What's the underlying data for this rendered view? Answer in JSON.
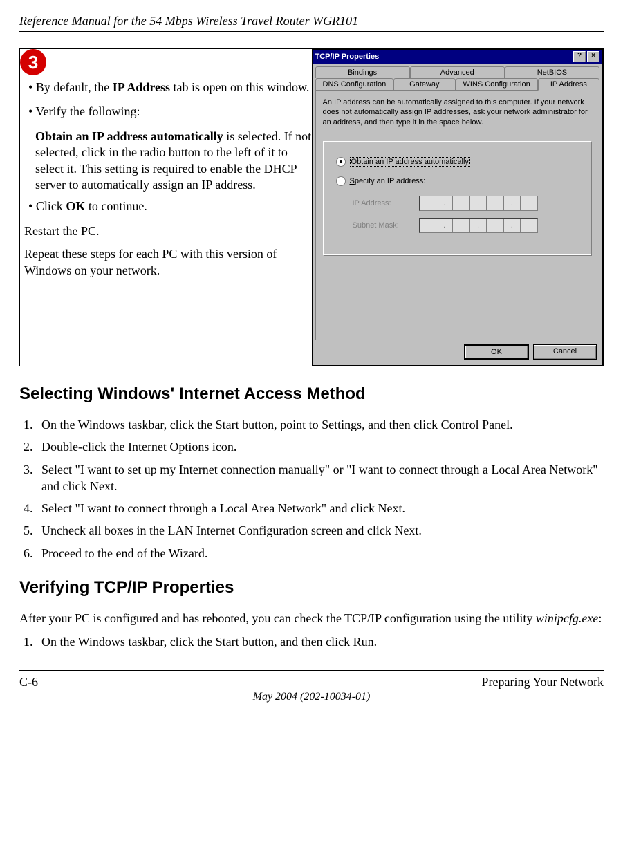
{
  "header": {
    "title": "Reference Manual for the 54 Mbps Wireless Travel Router WGR101"
  },
  "step": {
    "number": "3",
    "bullet1_pre": "By default, the ",
    "bullet1_bold": "IP Address",
    "bullet1_post": " tab is open on this window.",
    "bullet2": "Verify the following:",
    "sub_bold": "Obtain an IP address automatically",
    "sub_rest": " is selected. If not selected, click in the radio button to the left of it to select it.  This setting is required to enable the DHCP server to automatically assign an IP address.",
    "bullet3_pre": "Click ",
    "bullet3_bold": "OK",
    "bullet3_post": " to continue.",
    "plain1": "Restart the PC.",
    "plain2": "Repeat these steps for each PC with this version of Windows on your network."
  },
  "dialog": {
    "title": "TCP/IP Properties",
    "help_glyph": "?",
    "close_glyph": "×",
    "tabs_row1": [
      "Bindings",
      "Advanced",
      "NetBIOS"
    ],
    "tabs_row2": [
      "DNS Configuration",
      "Gateway",
      "WINS Configuration",
      "IP Address"
    ],
    "desc": "An IP address can be automatically assigned to this computer. If your network does not automatically assign IP addresses, ask your network administrator for an address, and then type it in the space below.",
    "radio_auto": "Obtain an IP address automatically",
    "radio_specify": "Specify an IP address:",
    "lbl_ip": "IP Address:",
    "lbl_mask": "Subnet Mask:",
    "dot": ".",
    "ok": "OK",
    "cancel": "Cancel"
  },
  "section1": {
    "title": "Selecting Windows' Internet Access Method",
    "steps": [
      "On the Windows taskbar, click the Start button, point to Settings, and then click Control Panel.",
      "Double-click the Internet Options icon.",
      "Select \"I want to set up my Internet connection manually\" or \"I want to connect through a Local Area Network\" and click Next.",
      "Select \"I want to connect through a Local Area Network\" and click Next.",
      "Uncheck all boxes in the LAN Internet Configuration screen and click Next.",
      "Proceed to the end of the Wizard."
    ]
  },
  "section2": {
    "title": "Verifying TCP/IP Properties",
    "intro_pre": "After your PC is configured and has rebooted, you can check the TCP/IP configuration using the utility ",
    "intro_italic": "winipcfg.exe",
    "intro_post": ":",
    "steps": [
      "On the Windows taskbar, click the Start button, and then click Run."
    ]
  },
  "footer": {
    "left": "C-6",
    "right": "Preparing Your Network",
    "center": "May 2004 (202-10034-01)"
  }
}
